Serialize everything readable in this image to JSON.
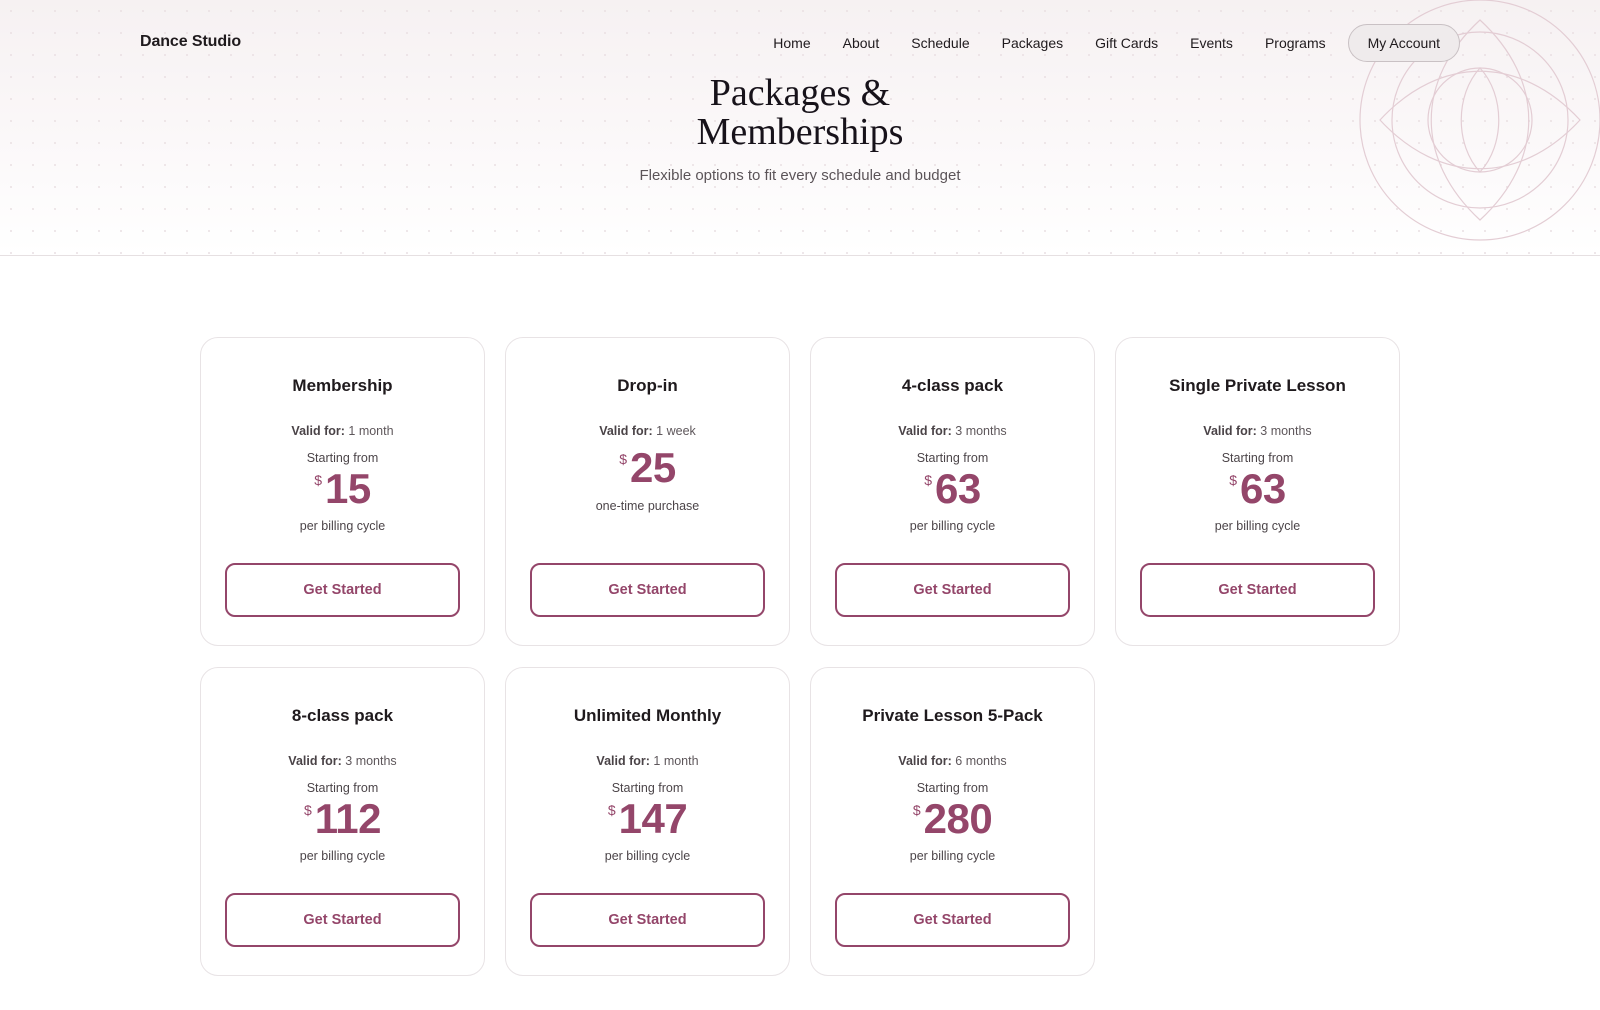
{
  "brand": {
    "name": "Dance Studio"
  },
  "nav": {
    "items": [
      "Home",
      "About",
      "Schedule",
      "Packages",
      "Gift Cards",
      "Events",
      "Programs"
    ],
    "account_label": "My Account"
  },
  "hero": {
    "title_line1": "Packages &",
    "title_line2": "Memberships",
    "subtitle": "Flexible options to fit every schedule and budget"
  },
  "colors": {
    "accent": "#94466a",
    "hero_bg": "#f6f1f2",
    "card_border": "#e8e3e5",
    "text": "#1f1a1d"
  },
  "icons": {
    "hero_decoration": "geometric-circle-ornament-icon"
  },
  "packages": [
    {
      "title": "Membership",
      "valid_label": "Valid for:",
      "valid_value": "1 month",
      "starting": "Starting from",
      "currency": "$",
      "price": "15",
      "note": "per billing cycle",
      "cta": "Get Started"
    },
    {
      "title": "Drop-in",
      "valid_label": "Valid for:",
      "valid_value": "1 week",
      "starting": "",
      "currency": "$",
      "price": "25",
      "note": "one-time purchase",
      "cta": "Get Started"
    },
    {
      "title": "4-class pack",
      "valid_label": "Valid for:",
      "valid_value": "3 months",
      "starting": "Starting from",
      "currency": "$",
      "price": "63",
      "note": "per billing cycle",
      "cta": "Get Started"
    },
    {
      "title": "Single Private Lesson",
      "valid_label": "Valid for:",
      "valid_value": "3 months",
      "starting": "Starting from",
      "currency": "$",
      "price": "63",
      "note": "per billing cycle",
      "cta": "Get Started"
    },
    {
      "title": "8-class pack",
      "valid_label": "Valid for:",
      "valid_value": "3 months",
      "starting": "Starting from",
      "currency": "$",
      "price": "112",
      "note": "per billing cycle",
      "cta": "Get Started"
    },
    {
      "title": "Unlimited Monthly",
      "valid_label": "Valid for:",
      "valid_value": "1 month",
      "starting": "Starting from",
      "currency": "$",
      "price": "147",
      "note": "per billing cycle",
      "cta": "Get Started"
    },
    {
      "title": "Private Lesson 5-Pack",
      "valid_label": "Valid for:",
      "valid_value": "6 months",
      "starting": "Starting from",
      "currency": "$",
      "price": "280",
      "note": "per billing cycle",
      "cta": "Get Started"
    }
  ]
}
